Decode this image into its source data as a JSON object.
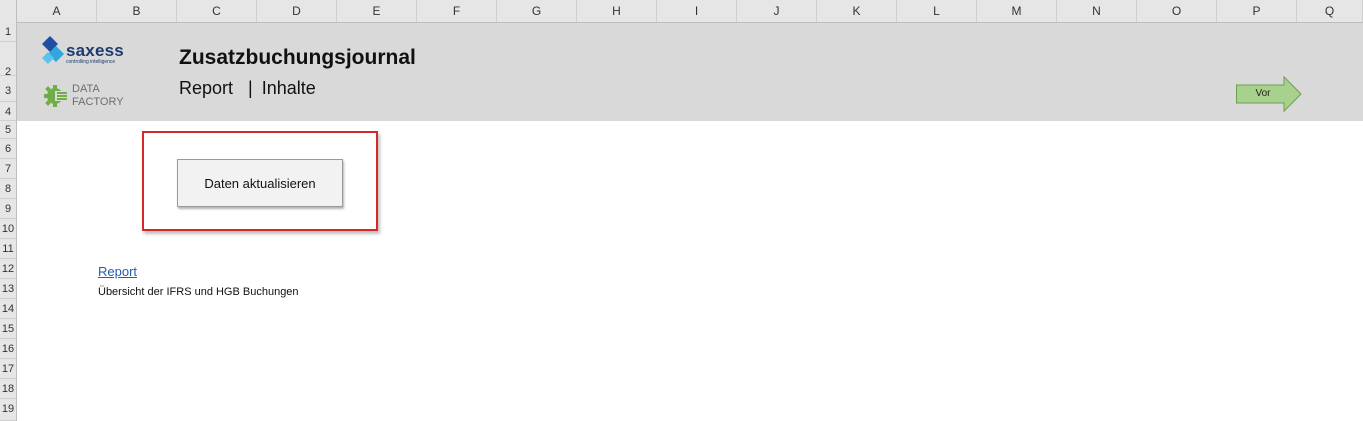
{
  "spreadsheet": {
    "columns": [
      "A",
      "B",
      "C",
      "D",
      "E",
      "F",
      "G",
      "H",
      "I",
      "J",
      "K",
      "L",
      "M",
      "N",
      "O",
      "P",
      "Q"
    ],
    "rows": [
      "1",
      "2",
      "3",
      "4",
      "5",
      "6",
      "7",
      "8",
      "9",
      "10",
      "11",
      "12",
      "13",
      "14",
      "15",
      "16",
      "17",
      "18",
      "19"
    ]
  },
  "banner": {
    "saxess_logo_text": "saxess",
    "saxess_tagline": "controlling intelligence",
    "datafactory_line1": "DATA",
    "datafactory_line2": "FACTORY",
    "title": "Zusatzbuchungsjournal",
    "subtitle_report": "Report",
    "subtitle_separator": "|",
    "subtitle_contents": "Inhalte",
    "next_button_label": "Vor"
  },
  "actions": {
    "refresh_button_label": "Daten aktualisieren"
  },
  "links": {
    "report_link_label": "Report",
    "report_description": "Übersicht der IFRS und HGB Buchungen"
  },
  "colors": {
    "banner_bg": "#d9d9d9",
    "frame_red": "#d62828",
    "arrow_green": "#a9d18e",
    "link_blue": "#1f5fb8",
    "saxess_blue": "#1d3b6e",
    "df_green": "#70ad47"
  },
  "icons": {
    "saxess": "saxess-diamond-icon",
    "datafactory": "gear-icon",
    "next": "arrow-right-icon"
  }
}
